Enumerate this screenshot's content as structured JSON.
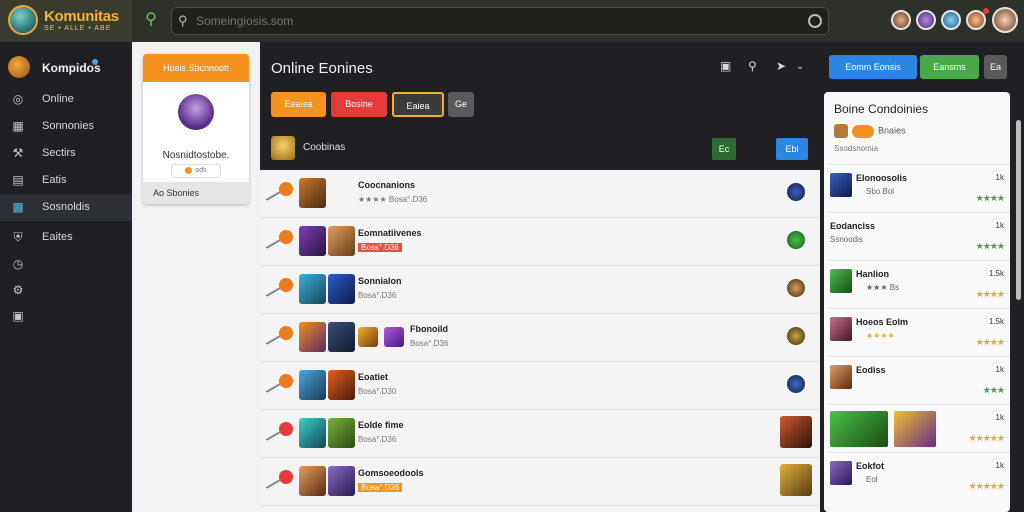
{
  "app": {
    "title": "Komunitas",
    "subtitle": "SE  • ALLE • ABE"
  },
  "search": {
    "placeholder": "Someingiosis.som"
  },
  "sidebar": {
    "header": "Kompidos",
    "items": [
      {
        "icon": "compass-icon",
        "label": "Online"
      },
      {
        "icon": "grid-icon",
        "label": "Sonnonies"
      },
      {
        "icon": "wrench-icon",
        "label": "Sectirs"
      },
      {
        "icon": "card-icon",
        "label": "Eatis"
      },
      {
        "icon": "puzzle-icon",
        "label": "Sosnoldis"
      },
      {
        "icon": "shield-icon",
        "label": "Eaites"
      }
    ]
  },
  "profile": {
    "header": "Hoeis Sbcnnoott",
    "username": "Nosnidtostobe.",
    "chip": "ods",
    "footer": "Ao Sbonies"
  },
  "main": {
    "title": "Online Eonines",
    "filters": [
      "Eeaiea",
      "Bosine",
      "Eaiea",
      "Ge"
    ],
    "subheader": "Coobinas",
    "small_buttons": [
      "Ec",
      "Ebl"
    ],
    "rows": [
      {
        "name": "Coocnanions",
        "meta": "★★★★ Bosa°.D36"
      },
      {
        "name": "Eomnatiivenes",
        "meta": "Boss°.D36"
      },
      {
        "name": "Sonnialon",
        "meta": "Bosa°.D36"
      },
      {
        "name": "Fbonoild",
        "meta": "Bosa°.D36"
      },
      {
        "name": "Eoatiet",
        "meta": "Bosa°.D30"
      },
      {
        "name": "Eolde fime",
        "meta": "Bosa°.D36"
      },
      {
        "name": "Gomsoeodools",
        "meta": "Bosa°.D36"
      }
    ]
  },
  "right": {
    "buttons": [
      "Eomm Eonsis",
      "Eansms",
      "Ea"
    ],
    "card_title": "Boine Condoinies",
    "card_sub": "Bnaies",
    "card_sub2": "Ssodsnomia",
    "items": [
      {
        "name": "Elonoosolis",
        "meta": "Sbo Bol",
        "count": "1k",
        "rating": "★★★★"
      },
      {
        "name": "Eodanciss",
        "meta": "Ssnoodis",
        "count": "1k",
        "rating": "★★★★"
      },
      {
        "name": "Hanlion",
        "meta": "★★★ Bs",
        "count": "1.5k",
        "rating": "★★★★"
      },
      {
        "name": "Hoeos Eolm",
        "meta": "★★★★",
        "count": "1.5k",
        "rating": "★★★★"
      },
      {
        "name": "Eodiss",
        "meta": "",
        "count": "1k",
        "rating": "★★★"
      },
      {
        "name": "",
        "meta": "",
        "count": "1k",
        "rating": "★★★★★"
      },
      {
        "name": "Eokfot",
        "meta": "Eol",
        "count": "1k",
        "rating": "★★★★★"
      }
    ]
  },
  "colors": {
    "orange": "#f4931f",
    "red": "#e53b3b",
    "blue": "#2b87e3",
    "green": "#4aa84a",
    "gold": "#f3b534"
  }
}
